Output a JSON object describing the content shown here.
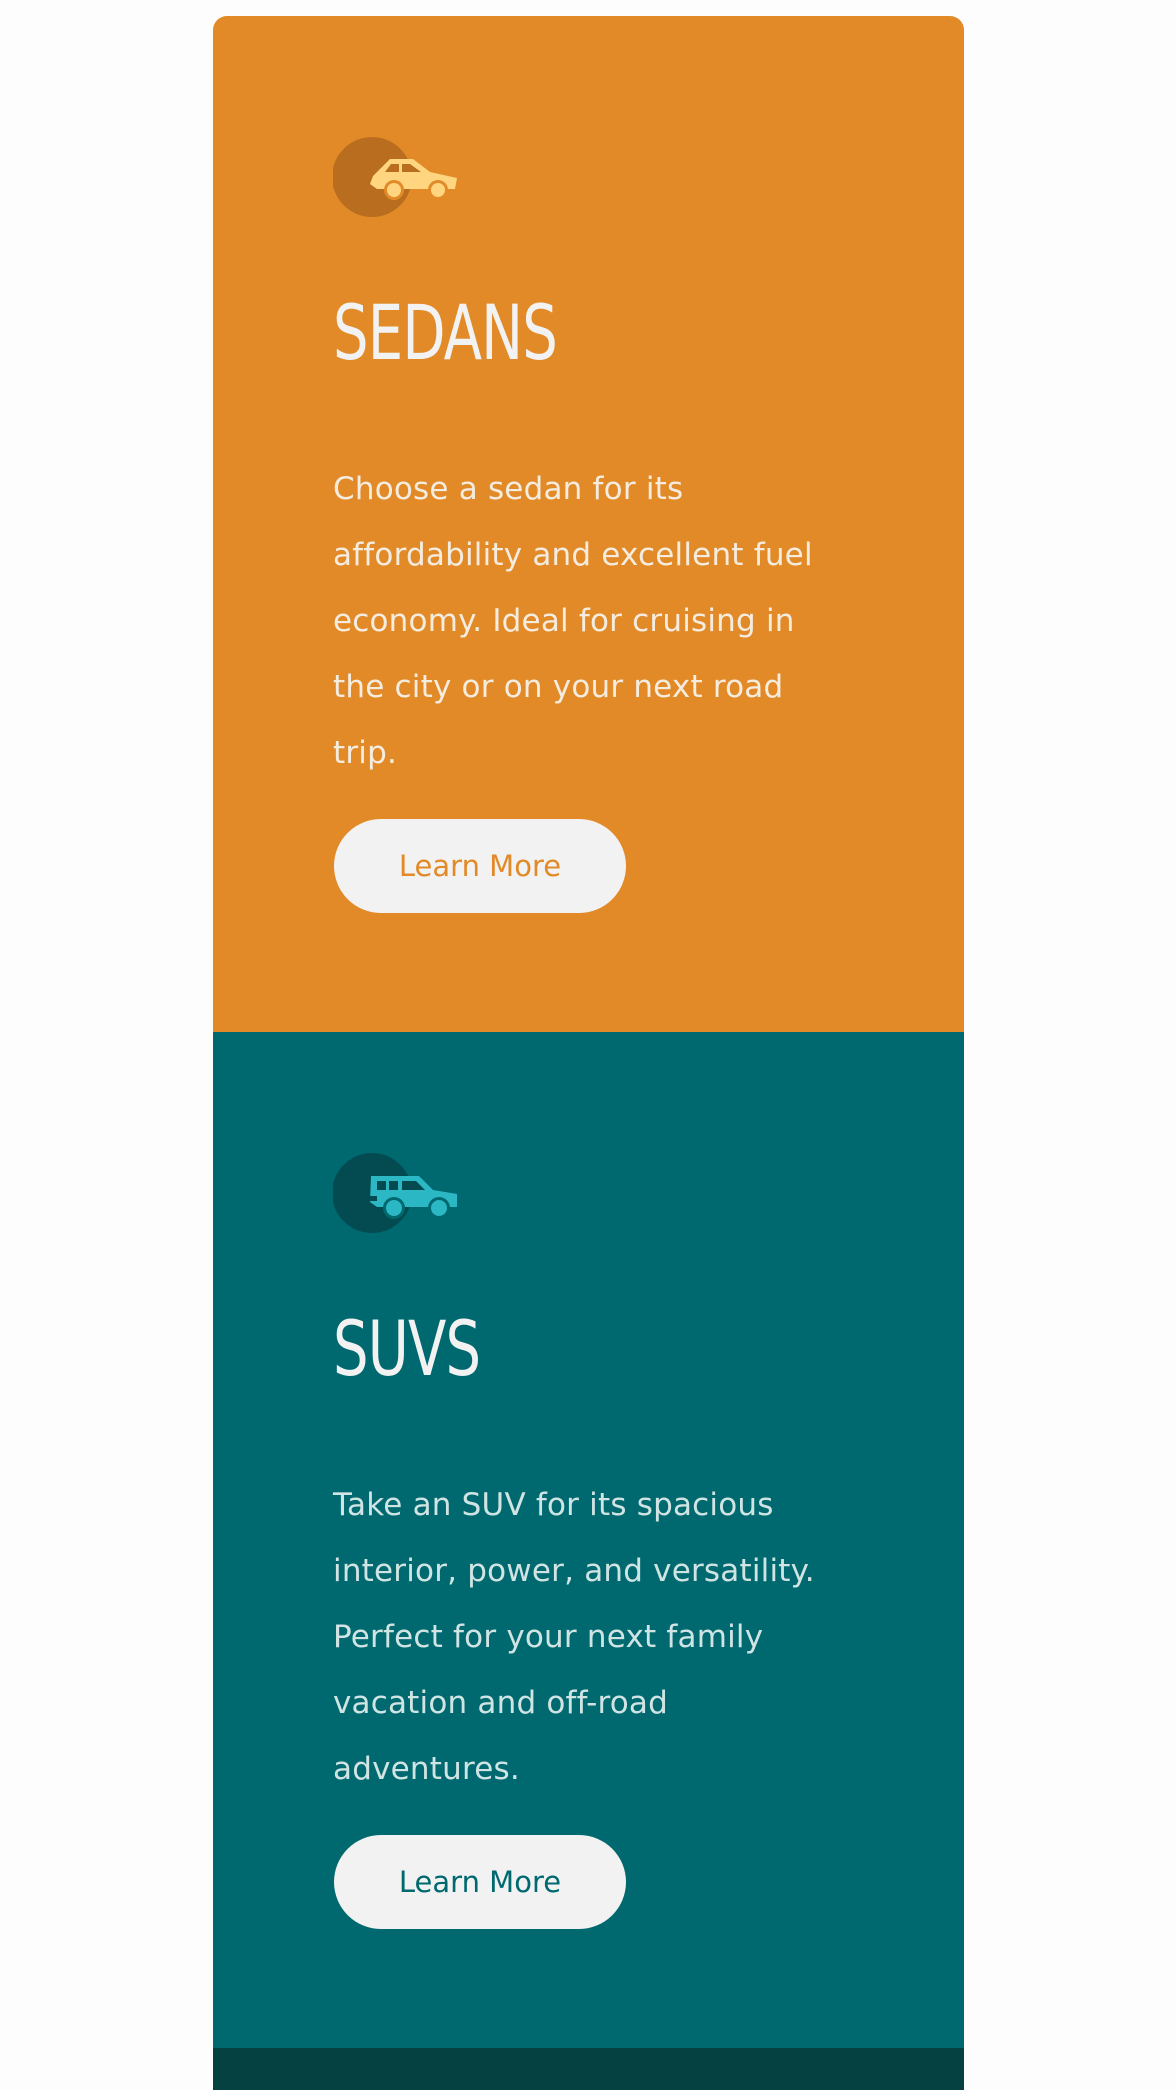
{
  "cards": [
    {
      "id": "sedans",
      "icon": "sedan-car-icon",
      "title": "SEDANS",
      "text": "Choose a sedan for its affordability and excellent fuel economy. Ideal for cruising in the city or on your next road trip.",
      "button_label": "Learn More",
      "colors": {
        "background": "#e28a28",
        "icon_circle": "#b96d1f",
        "icon_car": "#ffd57f"
      }
    },
    {
      "id": "suvs",
      "icon": "suv-car-icon",
      "title": "SUVS",
      "text": "Take an SUV for its spacious interior, power, and versatility. Perfect for your next family vacation and off-road adventures.",
      "button_label": "Learn More",
      "colors": {
        "background": "#006970",
        "icon_circle": "#034b50",
        "icon_car": "#2bb7c4"
      }
    },
    {
      "id": "luxury",
      "colors": {
        "background": "#044140"
      }
    }
  ]
}
